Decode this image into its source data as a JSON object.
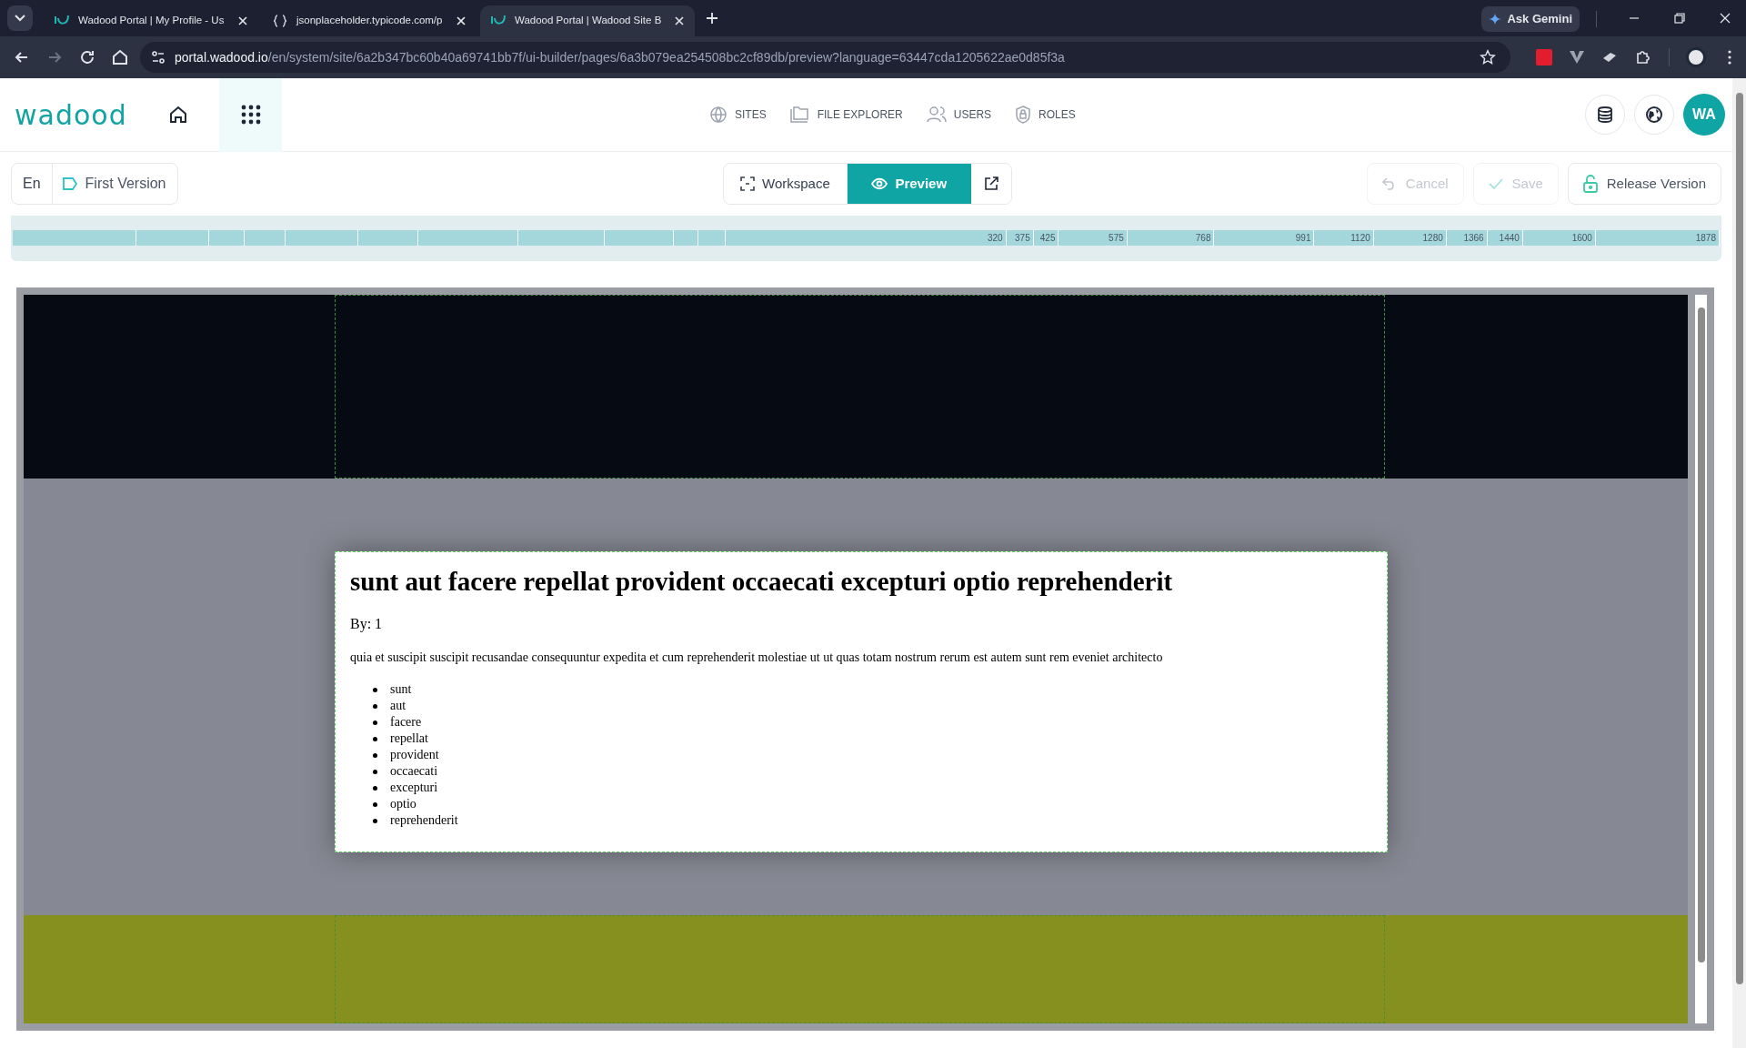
{
  "browser": {
    "tabs": [
      {
        "title": "Wadood Portal | My Profile - Us",
        "selected": false
      },
      {
        "title": "jsonplaceholder.typicode.com/p",
        "selected": false
      },
      {
        "title": "Wadood Portal | Wadood Site B",
        "selected": true
      }
    ],
    "gemini": "Ask Gemini",
    "url": {
      "host": "portal.wadood.io",
      "path": "/en/system/site/6a2b347bc60b40a69741bb7f/ui-builder/pages/6a3b079ea254508bc2cf89db/preview?language=63447cda1205622ae0d85f3a"
    }
  },
  "header": {
    "logo": "wadood",
    "nav": [
      {
        "label": "SITES"
      },
      {
        "label": "FILE EXPLORER"
      },
      {
        "label": "USERS"
      },
      {
        "label": "ROLES"
      }
    ],
    "avatar": "WA"
  },
  "toolbar": {
    "language": "En",
    "version": "First Version",
    "views": [
      {
        "label": "Workspace",
        "selected": false
      },
      {
        "label": "Preview",
        "selected": true
      }
    ],
    "actions": [
      {
        "label": "Cancel",
        "disabled": true
      },
      {
        "label": "Save",
        "disabled": true
      },
      {
        "label": "Release Version",
        "disabled": false
      }
    ]
  },
  "ruler": [
    "320",
    "375",
    "425",
    "575",
    "768",
    "991",
    "1120",
    "1280",
    "1366",
    "1440",
    "1600",
    "1878"
  ],
  "preview": {
    "title": "sunt aut facere repellat provident occaecati excepturi optio reprehenderit",
    "byline": "By: 1",
    "body": "quia et suscipit suscipit recusandae consequuntur expedita et cum reprehenderit molestiae ut ut quas totam nostrum rerum est autem sunt rem eveniet architecto",
    "tags": [
      "sunt",
      "aut",
      "facere",
      "repellat",
      "provident",
      "occaecati",
      "excepturi",
      "optio",
      "reprehenderit"
    ]
  }
}
